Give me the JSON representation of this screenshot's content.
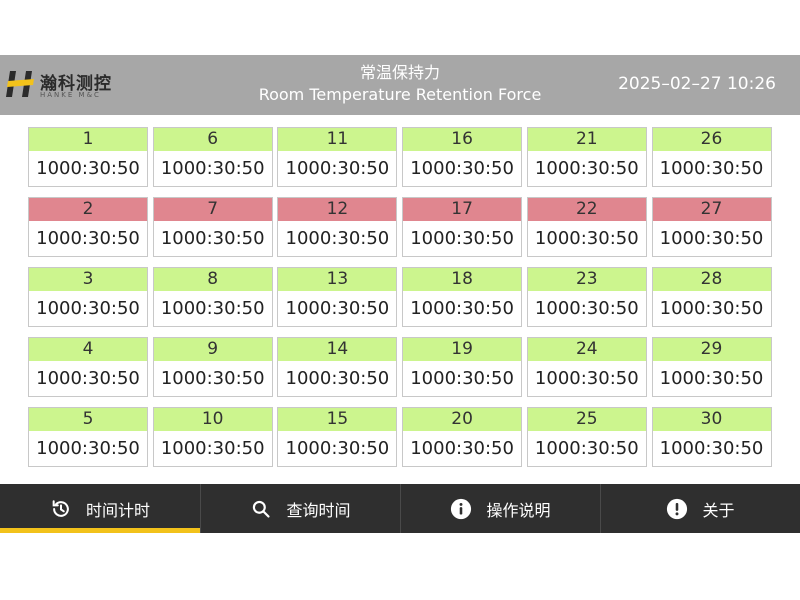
{
  "header": {
    "logo_cn": "瀚科测控",
    "logo_en": "HANKE M&C",
    "title_cn": "常温保持力",
    "title_en": "Room Temperature Retention Force",
    "datetime": "2025–02–27 10:26",
    "background": "#a7a7a7"
  },
  "colors": {
    "ok": "#ccf58e",
    "alarm": "#e0868f",
    "nav_bg": "#2f2f2f",
    "nav_active": "#f2c21b"
  },
  "stations": [
    {
      "id": "1",
      "time": "1000:30:50",
      "state": "green"
    },
    {
      "id": "2",
      "time": "1000:30:50",
      "state": "red"
    },
    {
      "id": "3",
      "time": "1000:30:50",
      "state": "green"
    },
    {
      "id": "4",
      "time": "1000:30:50",
      "state": "green"
    },
    {
      "id": "5",
      "time": "1000:30:50",
      "state": "green"
    },
    {
      "id": "6",
      "time": "1000:30:50",
      "state": "green"
    },
    {
      "id": "7",
      "time": "1000:30:50",
      "state": "red"
    },
    {
      "id": "8",
      "time": "1000:30:50",
      "state": "green"
    },
    {
      "id": "9",
      "time": "1000:30:50",
      "state": "green"
    },
    {
      "id": "10",
      "time": "1000:30:50",
      "state": "green"
    },
    {
      "id": "11",
      "time": "1000:30:50",
      "state": "green"
    },
    {
      "id": "12",
      "time": "1000:30:50",
      "state": "red"
    },
    {
      "id": "13",
      "time": "1000:30:50",
      "state": "green"
    },
    {
      "id": "14",
      "time": "1000:30:50",
      "state": "green"
    },
    {
      "id": "15",
      "time": "1000:30:50",
      "state": "green"
    },
    {
      "id": "16",
      "time": "1000:30:50",
      "state": "green"
    },
    {
      "id": "17",
      "time": "1000:30:50",
      "state": "red"
    },
    {
      "id": "18",
      "time": "1000:30:50",
      "state": "green"
    },
    {
      "id": "19",
      "time": "1000:30:50",
      "state": "green"
    },
    {
      "id": "20",
      "time": "1000:30:50",
      "state": "green"
    },
    {
      "id": "21",
      "time": "1000:30:50",
      "state": "green"
    },
    {
      "id": "22",
      "time": "1000:30:50",
      "state": "red"
    },
    {
      "id": "23",
      "time": "1000:30:50",
      "state": "green"
    },
    {
      "id": "24",
      "time": "1000:30:50",
      "state": "green"
    },
    {
      "id": "25",
      "time": "1000:30:50",
      "state": "green"
    },
    {
      "id": "26",
      "time": "1000:30:50",
      "state": "green"
    },
    {
      "id": "27",
      "time": "1000:30:50",
      "state": "red"
    },
    {
      "id": "28",
      "time": "1000:30:50",
      "state": "green"
    },
    {
      "id": "29",
      "time": "1000:30:50",
      "state": "green"
    },
    {
      "id": "30",
      "time": "1000:30:50",
      "state": "green"
    }
  ],
  "nav": [
    {
      "label": "时间计时",
      "icon": "history-clock-icon",
      "active": true
    },
    {
      "label": "查询时间",
      "icon": "search-icon",
      "active": false
    },
    {
      "label": "操作说明",
      "icon": "info-icon",
      "active": false
    },
    {
      "label": "关于",
      "icon": "exclamation-icon",
      "active": false
    }
  ]
}
